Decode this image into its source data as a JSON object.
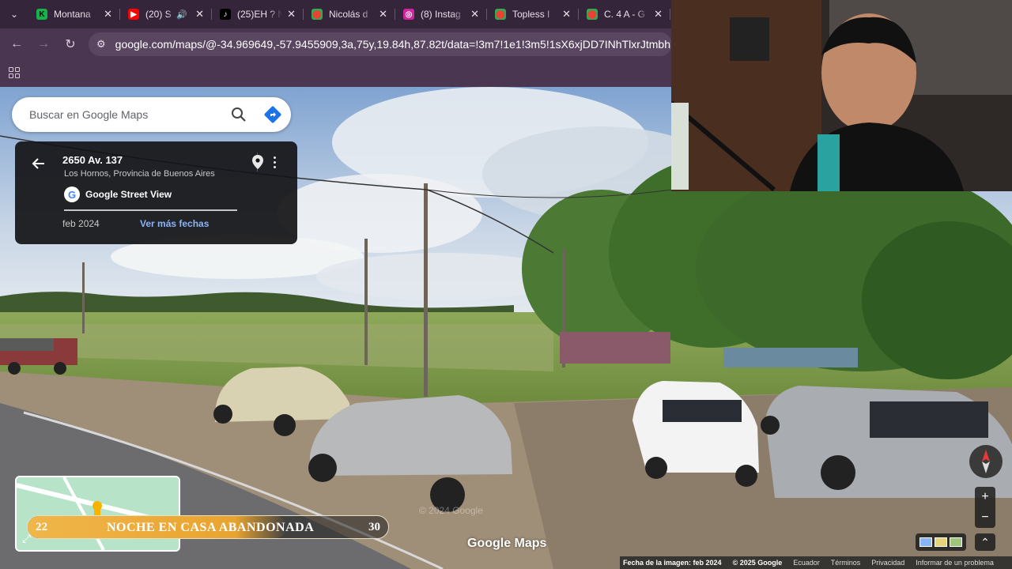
{
  "browser": {
    "tabs": [
      {
        "title": "Montana",
        "fav_color": "#16b34a",
        "fav_glyph": "K",
        "fav_text": "#111"
      },
      {
        "title": "(20) S",
        "fav_color": "#ff0000",
        "fav_glyph": "▶",
        "fav_text": "#fff",
        "audio": true
      },
      {
        "title": "(25)EH ? N",
        "fav_color": "#000000",
        "fav_glyph": "♪",
        "fav_text": "#fff"
      },
      {
        "title": "Nicolás d",
        "fav_color": "#34a853",
        "fav_glyph": "⬤",
        "fav_text": "#ea4335"
      },
      {
        "title": "(8) Instag",
        "fav_color": "#d6249f",
        "fav_glyph": "◎",
        "fav_text": "#fff"
      },
      {
        "title": "Topless I",
        "fav_color": "#34a853",
        "fav_glyph": "⬤",
        "fav_text": "#ea4335"
      },
      {
        "title": "C. 4 A - G",
        "fav_color": "#34a853",
        "fav_glyph": "⬤",
        "fav_text": "#ea4335"
      }
    ],
    "url": "google.com/maps/@-34.969649,-57.9455909,3a,75y,19.84h,87.82t/data=!3m7!1e1!3m5!1sX6xjDD7INhTlxrJtmbhP9g!2e0!"
  },
  "search": {
    "placeholder": "Buscar en Google Maps"
  },
  "card": {
    "address": "2650 Av. 137",
    "locality": "Los Hornos, Provincia de Buenos Aires",
    "source": "Google Street View",
    "date": "feb 2024",
    "more_dates": "Ver más fechas"
  },
  "overlay": {
    "title": "NOCHE EN CASA ABANDONADA",
    "start": "22",
    "end": "30",
    "progress_fraction": 0.72
  },
  "watermark": "Google Maps",
  "footer": {
    "image_date": "Fecha de la imagen: feb 2024",
    "copyright": "© 2025 Google",
    "country": "Ecuador",
    "terms": "Términos",
    "privacy": "Privacidad",
    "report": "Informar de un problema"
  },
  "controls": {
    "zoom_in": "+",
    "zoom_out": "−",
    "collapse": "⌃"
  }
}
